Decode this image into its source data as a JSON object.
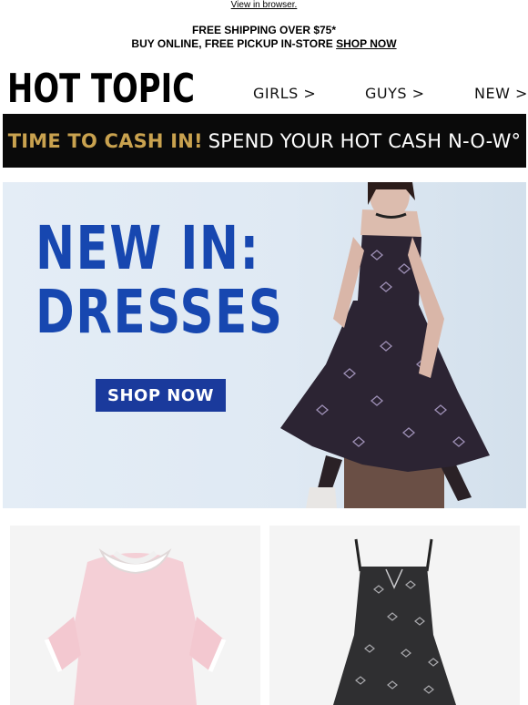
{
  "header": {
    "view_in_browser": "View in browser."
  },
  "promo": {
    "line1": "FREE SHIPPING OVER $75*",
    "line2_prefix": "BUY ONLINE, FREE PICKUP IN-STORE ",
    "line2_link": "SHOP NOW"
  },
  "nav": {
    "logo_text": "HOT TOPIC",
    "links": [
      {
        "label": "GIRLS >"
      },
      {
        "label": "GUYS >"
      },
      {
        "label": "NEW >"
      }
    ]
  },
  "cash_banner": {
    "gold_text": "TIME TO CASH IN!",
    "white_text": "SPEND YOUR HOT CASH N-O-W°"
  },
  "hero": {
    "title_line1": "NEW IN:",
    "title_line2": "DRESSES",
    "button_label": "SHOP NOW"
  },
  "colors": {
    "hero_title": "#1747b0",
    "hero_button": "#1a3a9c",
    "cash_gold": "#c9a24f",
    "banner_bg": "#0a0a0a"
  }
}
